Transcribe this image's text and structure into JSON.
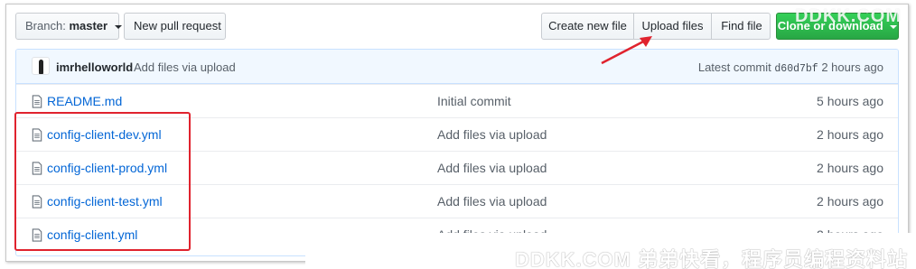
{
  "toolbar": {
    "branch_label": "Branch:",
    "branch_value": "master",
    "new_pr": "New pull request",
    "create_file": "Create new file",
    "upload_files": "Upload files",
    "find_file": "Find file",
    "clone": "Clone or download"
  },
  "commit": {
    "author": "imrhelloworld",
    "message": "Add files via upload",
    "latest_label": "Latest commit",
    "sha": "d60d7bf",
    "time": "2 hours ago"
  },
  "files": [
    {
      "name": "README.md",
      "message": "Initial commit",
      "age": "5 hours ago"
    },
    {
      "name": "config-client-dev.yml",
      "message": "Add files via upload",
      "age": "2 hours ago"
    },
    {
      "name": "config-client-prod.yml",
      "message": "Add files via upload",
      "age": "2 hours ago"
    },
    {
      "name": "config-client-test.yml",
      "message": "Add files via upload",
      "age": "2 hours ago"
    },
    {
      "name": "config-client.yml",
      "message": "Add files via upload",
      "age": "2 hours ago"
    }
  ],
  "watermark": {
    "top": "DDKK.COM",
    "bottom": "DDKK.COM 弟弟快看，程序员编程资料站"
  },
  "colors": {
    "link": "#0366d6",
    "annotation": "#e0232e",
    "clone_green": "#28a745"
  }
}
